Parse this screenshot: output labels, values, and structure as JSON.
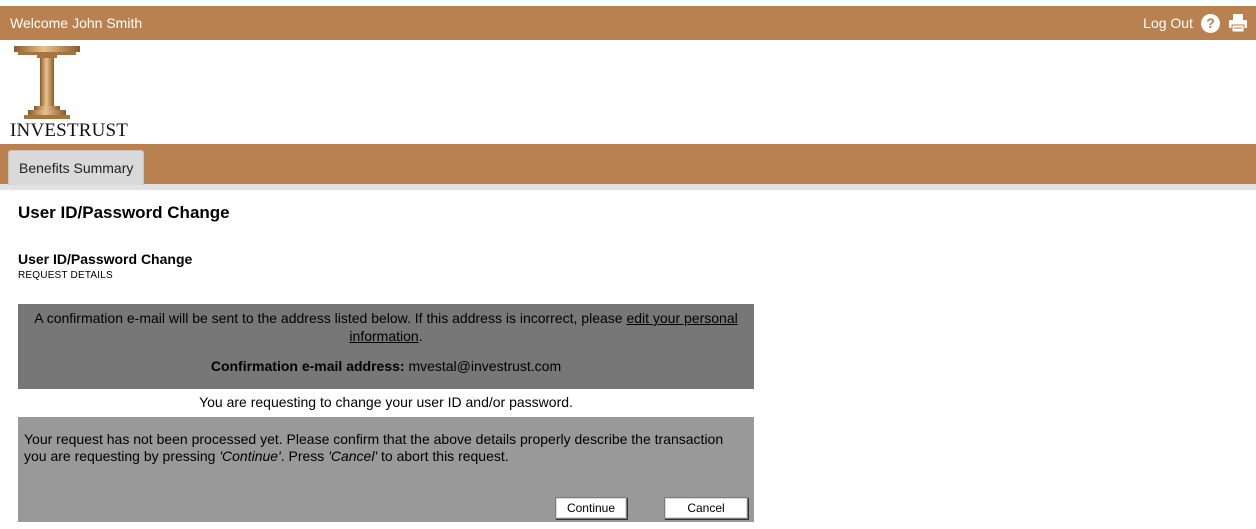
{
  "header": {
    "welcome_label": "Welcome",
    "user_name": "John Smith",
    "logout_label": "Log Out",
    "help_icon": "?",
    "print_icon": "printer-icon"
  },
  "brand": {
    "logo_text": "INVESTRUST",
    "accent_color": "#b98150"
  },
  "nav": {
    "tabs": [
      {
        "label": "Benefits Summary"
      }
    ]
  },
  "page": {
    "title": "User ID/Password Change",
    "section_title": "User ID/Password Change",
    "section_subtitle": "REQUEST DETAILS"
  },
  "notice": {
    "text_before_link": "A confirmation e-mail will be sent to the address listed below. If this address is incorrect, please ",
    "link_text": "edit your personal information",
    "text_after_link": ".",
    "email_label": "Confirmation e-mail address:",
    "email_value": "mvestal@investrust.com"
  },
  "request_line": "You are requesting to change your user ID and/or password.",
  "confirm": {
    "text_1": "Your request has not been processed yet. Please confirm that the above details properly describe the transaction you are requesting by pressing ",
    "continue_ref": "'Continue'",
    "text_2": ". Press ",
    "cancel_ref": "'Cancel'",
    "text_3": " to abort this request.",
    "continue_button": "Continue",
    "cancel_button": "Cancel"
  }
}
